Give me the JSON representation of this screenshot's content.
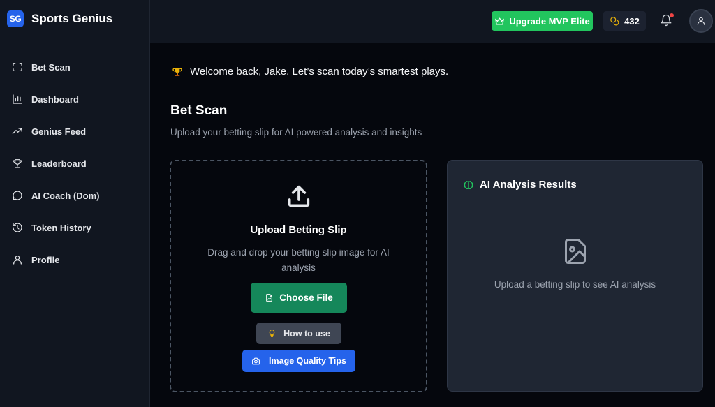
{
  "brand": {
    "logo_text": "SG",
    "name": "Sports Genius"
  },
  "sidebar": {
    "items": [
      {
        "label": "Bet Scan",
        "icon": "scan-icon"
      },
      {
        "label": "Dashboard",
        "icon": "bar-chart-icon"
      },
      {
        "label": "Genius Feed",
        "icon": "trending-up-icon"
      },
      {
        "label": "Leaderboard",
        "icon": "trophy-icon"
      },
      {
        "label": "AI Coach (Dom)",
        "icon": "chat-bubble-icon"
      },
      {
        "label": "Token History",
        "icon": "history-icon"
      },
      {
        "label": "Profile",
        "icon": "user-icon"
      }
    ]
  },
  "topbar": {
    "upgrade_label": "Upgrade MVP Elite",
    "token_count": "432",
    "notification_badge_color": "#ef4444"
  },
  "main": {
    "welcome": "Welcome back, Jake. Let’s scan today’s smartest plays.",
    "title": "Bet Scan",
    "subtitle": "Upload your betting slip for AI powered analysis and insights",
    "upload": {
      "title": "Upload Betting Slip",
      "description": "Drag and drop your betting slip image for AI analysis",
      "choose_file_label": "Choose File",
      "how_to_label": "How to use",
      "tips_label": "Image Quality Tips"
    },
    "results": {
      "title": "AI Analysis Results",
      "empty_text": "Upload a betting slip to see AI analysis"
    }
  },
  "colors": {
    "accent_green": "#22c55e",
    "button_green": "#15875a",
    "accent_blue": "#2563eb",
    "token_gold": "#eab308"
  }
}
